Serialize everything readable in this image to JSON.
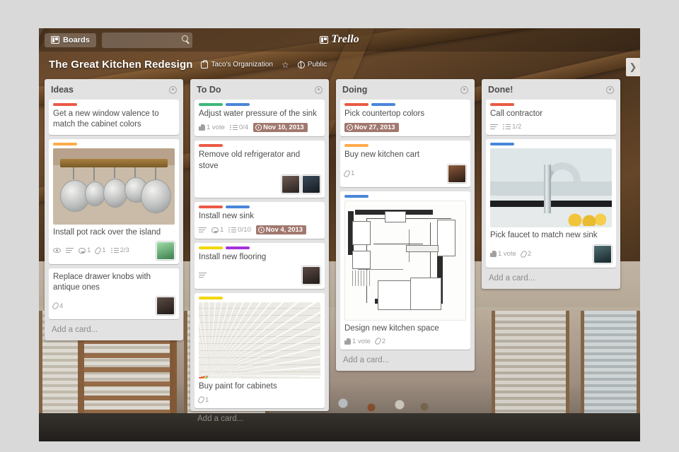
{
  "topbar": {
    "boards_label": "Boards",
    "search_placeholder": "",
    "search_icon": "search-icon",
    "logo_text": "Trello"
  },
  "board_header": {
    "title": "The Great Kitchen Redesign",
    "organization": "Taco's Organization",
    "star_glyph": "☆",
    "visibility": "Public",
    "sidebar_toggle_glyph": "❯"
  },
  "add_card_label": "Add a card...",
  "label_colors": {
    "red": "#eb5a46",
    "orange": "#ffab4a",
    "yellow": "#f2d600",
    "green": "#3cb878",
    "blue": "#4986d8",
    "purple": "#a632db"
  },
  "lists": [
    {
      "title": "Ideas",
      "cards": [
        {
          "title": "Get a new window valence to match the cabinet colors",
          "labels": [
            "red"
          ],
          "badges": [],
          "cover": null,
          "avatars": []
        },
        {
          "title": "Install pot rack over the island",
          "labels": [
            "orange"
          ],
          "cover": "pot-rack-photo",
          "badges": [
            {
              "icon": "eye-icon",
              "text": ""
            },
            {
              "icon": "description-icon",
              "text": ""
            },
            {
              "icon": "comment-icon",
              "text": "1"
            },
            {
              "icon": "attachment-icon",
              "text": "1"
            },
            {
              "icon": "checklist-icon",
              "text": "2/3"
            }
          ],
          "avatars": [
            "av-green"
          ]
        },
        {
          "title": "Replace drawer knobs with antique ones",
          "labels": [],
          "cover": null,
          "badges": [
            {
              "icon": "attachment-icon",
              "text": "4"
            }
          ],
          "avatars": [
            "av-dark"
          ]
        }
      ]
    },
    {
      "title": "To Do",
      "cards": [
        {
          "title": "Adjust water pressure of the sink",
          "labels": [
            "green",
            "blue"
          ],
          "cover": null,
          "badges": [
            {
              "icon": "vote-icon",
              "text": "1 vote"
            },
            {
              "icon": "checklist-icon",
              "text": "0/4"
            },
            {
              "icon": "clock-icon",
              "text": "Nov 10, 2013",
              "due": true
            }
          ],
          "avatars": []
        },
        {
          "title": "Remove old refrigerator and stove",
          "labels": [
            "red"
          ],
          "cover": null,
          "badges": [],
          "avatars": [
            "av-dark2",
            "av-blue"
          ]
        },
        {
          "title": "Install new sink",
          "labels": [
            "red",
            "blue"
          ],
          "cover": null,
          "badges": [
            {
              "icon": "description-icon",
              "text": ""
            },
            {
              "icon": "comment-icon",
              "text": "1"
            },
            {
              "icon": "checklist-icon",
              "text": "0/10"
            },
            {
              "icon": "clock-icon",
              "text": "Nov 4, 2013",
              "due": true
            }
          ],
          "avatars": []
        },
        {
          "title": "Install new flooring",
          "labels": [
            "yellow",
            "purple"
          ],
          "cover": null,
          "badges": [
            {
              "icon": "description-icon",
              "text": ""
            }
          ],
          "avatars": [
            "av-dark"
          ]
        },
        {
          "title": "Buy paint for cabinets",
          "labels": [
            "yellow"
          ],
          "cover": "paint-swatch-fan-photo",
          "badges": [
            {
              "icon": "attachment-icon",
              "text": "1"
            }
          ],
          "avatars": []
        }
      ]
    },
    {
      "title": "Doing",
      "cards": [
        {
          "title": "Pick countertop colors",
          "labels": [
            "red",
            "blue"
          ],
          "cover": null,
          "badges": [
            {
              "icon": "clock-icon",
              "text": "Nov 27, 2013",
              "due": true
            }
          ],
          "avatars": []
        },
        {
          "title": "Buy new kitchen cart",
          "labels": [
            "orange"
          ],
          "cover": null,
          "badges": [
            {
              "icon": "attachment-icon",
              "text": "1"
            }
          ],
          "avatars": [
            "av-warm"
          ]
        },
        {
          "title": "Design new kitchen space",
          "labels": [
            "blue"
          ],
          "cover": "kitchen-floorplan-drawing",
          "badges": [
            {
              "icon": "vote-icon",
              "text": "1 vote"
            },
            {
              "icon": "attachment-icon",
              "text": "2"
            }
          ],
          "avatars": []
        }
      ]
    },
    {
      "title": "Done!",
      "cards": [
        {
          "title": "Call contractor",
          "labels": [
            "red"
          ],
          "cover": null,
          "badges": [
            {
              "icon": "description-icon",
              "text": ""
            },
            {
              "icon": "checklist-icon",
              "text": "1/2"
            }
          ],
          "avatars": []
        },
        {
          "title": "Pick faucet to match new sink",
          "labels": [
            "blue"
          ],
          "cover": "kitchen-faucet-photo",
          "badges": [
            {
              "icon": "vote-icon",
              "text": "1 vote"
            },
            {
              "icon": "attachment-icon",
              "text": "2"
            }
          ],
          "avatars": [
            "av-teal"
          ]
        }
      ]
    }
  ]
}
